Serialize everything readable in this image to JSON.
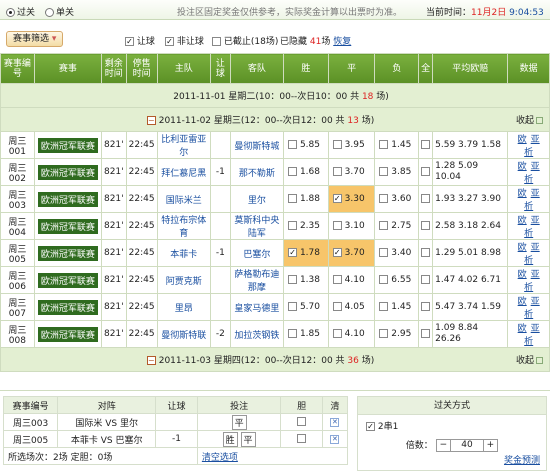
{
  "top": {
    "mode_pass": "过关",
    "mode_single": "单关",
    "notice": "投注区固定奖金仅供参考，实际奖金计算以出票时为准。",
    "time_label": "当前时间：",
    "date": "11月2日",
    "time": "9:04:53"
  },
  "filter": {
    "button": "赛事筛选",
    "let_ball": "让球",
    "no_let_ball": "非让球",
    "closed": "已截止(18场)",
    "hidden_prefix": "已隐藏",
    "hidden_count": "41",
    "hidden_suffix": "场",
    "restore": "恢复"
  },
  "headers": [
    "赛事编号",
    "赛事",
    "剩余时间",
    "停售时间",
    "主队",
    "让球",
    "客队",
    "胜",
    "平",
    "负",
    "全",
    "平均欧赔",
    "数据"
  ],
  "day1": {
    "label": "2011-11-01 星期二(10：00--次日10：00 共 ",
    "count": "18",
    "suffix": " 场)"
  },
  "day2": {
    "label": "2011-11-02 星期三(12：00--次日12：00 共 ",
    "count": "13",
    "suffix": " 场)",
    "collapse": "收起"
  },
  "day3": {
    "label": "2011-11-03 星期四(12：00--次日12：00 共 ",
    "count": "36",
    "suffix": " 场)",
    "collapse": "收起"
  },
  "matches": [
    {
      "id": "周三001",
      "league": "欧洲冠军联赛",
      "remain": "821'",
      "stop": "22:45",
      "home": "比利亚雷亚尔",
      "handicap": "",
      "away": "曼彻斯特城",
      "win": "5.85",
      "draw": "3.95",
      "lose": "1.45",
      "avg": "5.59 3.79 1.58"
    },
    {
      "id": "周三002",
      "league": "欧洲冠军联赛",
      "remain": "821'",
      "stop": "22:45",
      "home": "拜仁慕尼黑",
      "handicap": "-1",
      "away": "那不勒斯",
      "win": "1.68",
      "draw": "3.70",
      "lose": "3.85",
      "avg": "1.28 5.09 10.04"
    },
    {
      "id": "周三003",
      "league": "欧洲冠军联赛",
      "remain": "821'",
      "stop": "22:45",
      "home": "国际米兰",
      "handicap": "",
      "away": "里尔",
      "win": "1.88",
      "draw": "3.30",
      "lose": "3.60",
      "avg": "1.93 3.27 3.90"
    },
    {
      "id": "周三004",
      "league": "欧洲冠军联赛",
      "remain": "821'",
      "stop": "22:45",
      "home": "特拉布宗体育",
      "handicap": "",
      "away": "莫斯科中央陆军",
      "win": "2.35",
      "draw": "3.10",
      "lose": "2.75",
      "avg": "2.58 3.18 2.64"
    },
    {
      "id": "周三005",
      "league": "欧洲冠军联赛",
      "remain": "821'",
      "stop": "22:45",
      "home": "本菲卡",
      "handicap": "-1",
      "away": "巴塞尔",
      "win": "1.78",
      "draw": "3.70",
      "lose": "3.40",
      "avg": "1.29 5.01 8.98"
    },
    {
      "id": "周三006",
      "league": "欧洲冠军联赛",
      "remain": "821'",
      "stop": "22:45",
      "home": "阿贾克斯",
      "handicap": "",
      "away": "萨格勒布迪那摩",
      "win": "1.38",
      "draw": "4.10",
      "lose": "6.55",
      "avg": "1.47 4.02 6.71"
    },
    {
      "id": "周三007",
      "league": "欧洲冠军联赛",
      "remain": "821'",
      "stop": "22:45",
      "home": "里昂",
      "handicap": "",
      "away": "皇家马德里",
      "win": "5.70",
      "draw": "4.05",
      "lose": "1.45",
      "avg": "5.47 3.74 1.59"
    },
    {
      "id": "周三008",
      "league": "欧洲冠军联赛",
      "remain": "821'",
      "stop": "22:45",
      "home": "曼彻斯特联",
      "handicap": "-2",
      "away": "加拉茨钢铁",
      "win": "1.85",
      "draw": "4.10",
      "lose": "2.95",
      "avg": "1.09 8.84 26.26"
    }
  ],
  "data_links": [
    "欧",
    "亚",
    "析"
  ],
  "bet": {
    "headers": [
      "赛事编号",
      "对阵",
      "让球",
      "投注",
      "胆",
      "清"
    ],
    "rows": [
      {
        "id": "周三003",
        "home": "国际米",
        "vs": "VS",
        "away": "里尔",
        "handicap": "",
        "picks": [
          "平"
        ]
      },
      {
        "id": "周三005",
        "home": "本菲卡",
        "vs": "VS",
        "away": "巴塞尔",
        "handicap": "-1",
        "picks": [
          "胜",
          "平"
        ]
      }
    ],
    "summary_prefix": "所选场次：",
    "summary_count": "2",
    "summary_unit": "场 定胆：",
    "banker_count": "0",
    "banker_unit": "场",
    "clear": "清空选项"
  },
  "pass": {
    "title": "过关方式",
    "type": "2串1",
    "multiplier_label": "倍数：",
    "multiplier": "40",
    "prize_link": "奖金预测"
  }
}
